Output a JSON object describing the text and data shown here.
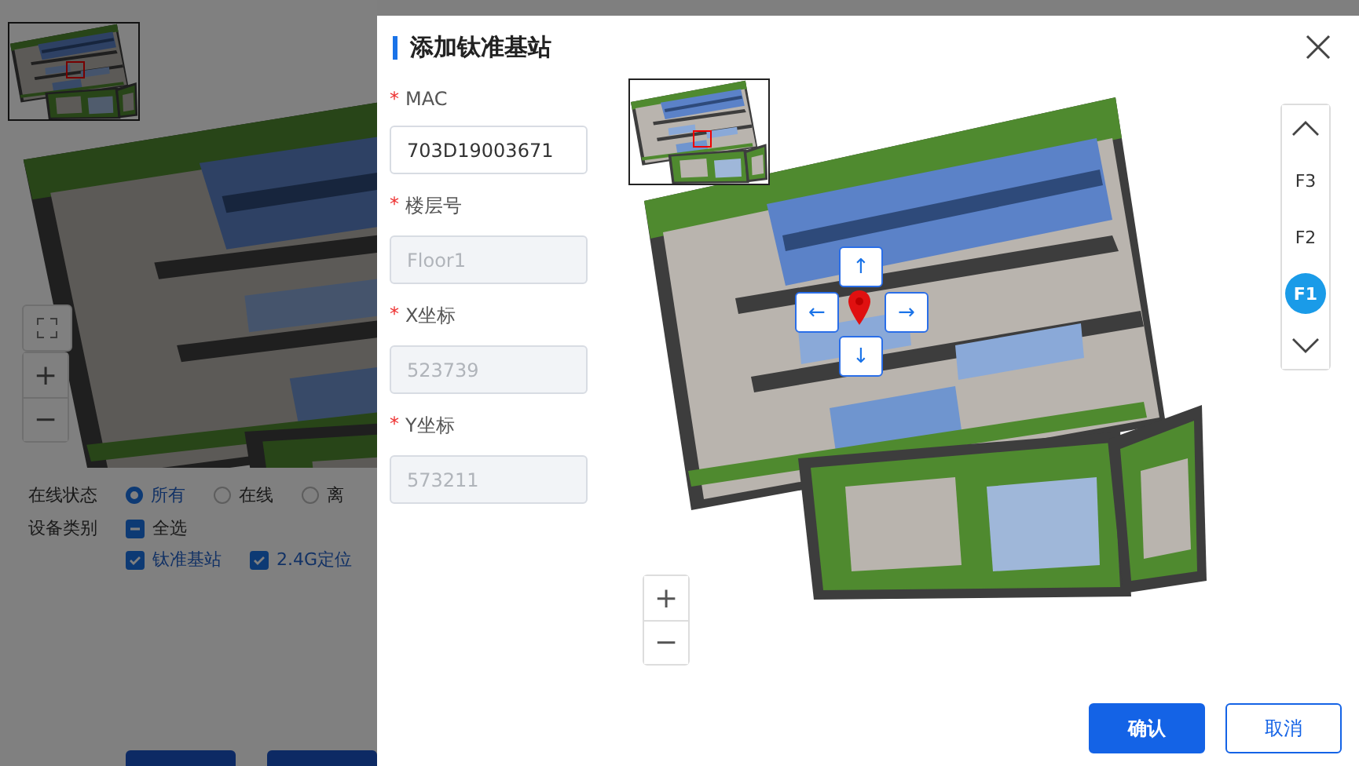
{
  "background": {
    "zoom": [
      "+",
      "−"
    ],
    "filters": [
      {
        "label": "在线状态",
        "kind": "radio",
        "options": [
          {
            "label": "所有",
            "selected": true
          },
          {
            "label": "在线",
            "selected": false
          },
          {
            "label": "离",
            "selected": false
          }
        ]
      },
      {
        "label": "设备类别",
        "kind": "checkbox",
        "options": [
          {
            "label": "全选",
            "checked": true,
            "indeterminate": true
          },
          {
            "label": "钛准基站",
            "checked": true
          },
          {
            "label": "2.4G定位",
            "checked": true
          }
        ]
      }
    ]
  },
  "dialog": {
    "title": "添加钛准基站",
    "fields": [
      {
        "mark": "*",
        "label": "MAC",
        "value": "703D19003671",
        "disabled": false
      },
      {
        "mark": "*",
        "label": "楼层号",
        "value": "Floor1",
        "disabled": true
      },
      {
        "mark": "*",
        "label": "X坐标",
        "value": "523739",
        "disabled": true
      },
      {
        "mark": "*",
        "label": "Y坐标",
        "value": "573211",
        "disabled": true
      }
    ],
    "map": {
      "arrows": [
        {
          "kind": "up",
          "symbol": "↑"
        },
        {
          "kind": "left",
          "symbol": "←"
        },
        {
          "kind": "right",
          "symbol": "→"
        },
        {
          "kind": "down",
          "symbol": "↓"
        }
      ],
      "floors": [
        {
          "label": "F3",
          "selected": false
        },
        {
          "label": "F2",
          "selected": false
        },
        {
          "label": "F1",
          "selected": true
        }
      ],
      "zoom": [
        "+",
        "−"
      ]
    },
    "buttons": [
      {
        "kind": "primary",
        "label": "确认"
      },
      {
        "kind": "secondary",
        "label": "取消"
      }
    ]
  }
}
